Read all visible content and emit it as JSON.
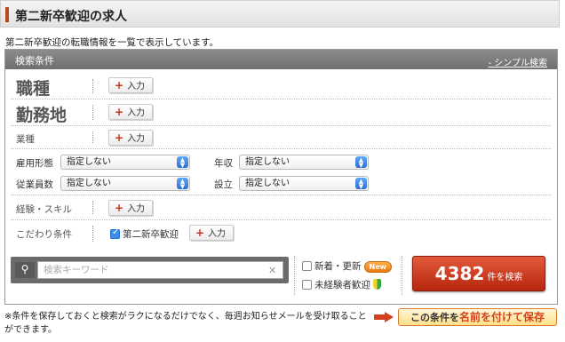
{
  "header": {
    "title": "第二新卒歓迎の求人"
  },
  "description": "第二新卒歓迎の転職情報を一覧で表示しています。",
  "panel": {
    "title": "検索条件",
    "simple_link": "- シンプル検索",
    "add_label": "入力",
    "rows": {
      "occupation": "職種",
      "location": "勤務地",
      "industry": "業種",
      "experience": "経験・スキル",
      "preferences": "こだわり条件"
    },
    "selects": {
      "employment_type": {
        "label": "雇用形態",
        "value": "指定しない"
      },
      "annual_income": {
        "label": "年収",
        "value": "指定しない"
      },
      "employee_count": {
        "label": "従業員数",
        "value": "指定しない"
      },
      "founded": {
        "label": "設立",
        "value": "指定しない"
      }
    },
    "preference_checkbox": {
      "label": "第二新卒歓迎",
      "checked": true
    },
    "keyword": {
      "placeholder": "検索キーワード",
      "value": ""
    },
    "options": {
      "new_arrivals": {
        "label": "新着・更新",
        "badge": "New",
        "checked": false
      },
      "inexperienced": {
        "label": "未経験者歓迎",
        "checked": false
      }
    },
    "submit": {
      "count": "4382",
      "suffix": "件を検索"
    }
  },
  "footer": {
    "note": "※条件を保存しておくと検索がラクになるだけでなく、毎週お知らせメールを受け取ることができます。",
    "save_prefix": "この条件を",
    "save_highlight": "名前を付けて保存"
  },
  "colors": {
    "accent": "#c4361c",
    "submit": "#c8341a",
    "panel_header": "#7d7d7d"
  }
}
